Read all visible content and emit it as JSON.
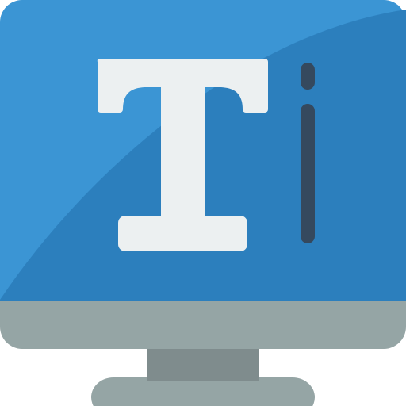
{
  "icon": {
    "name": "text-editor-monitor-icon",
    "parts": {
      "monitor": "monitor-icon",
      "glyph": "letter-t-glyph",
      "cursor": "text-cursor-icon"
    }
  },
  "colors": {
    "screen_light": "#3b95d4",
    "screen_dark": "#2c7fbd",
    "bezel": "#95a5a5",
    "stand_neck": "#7f8c8d",
    "stand_base": "#95a5a5",
    "glyph": "#ecf0f1",
    "cursor": "#35495e"
  }
}
